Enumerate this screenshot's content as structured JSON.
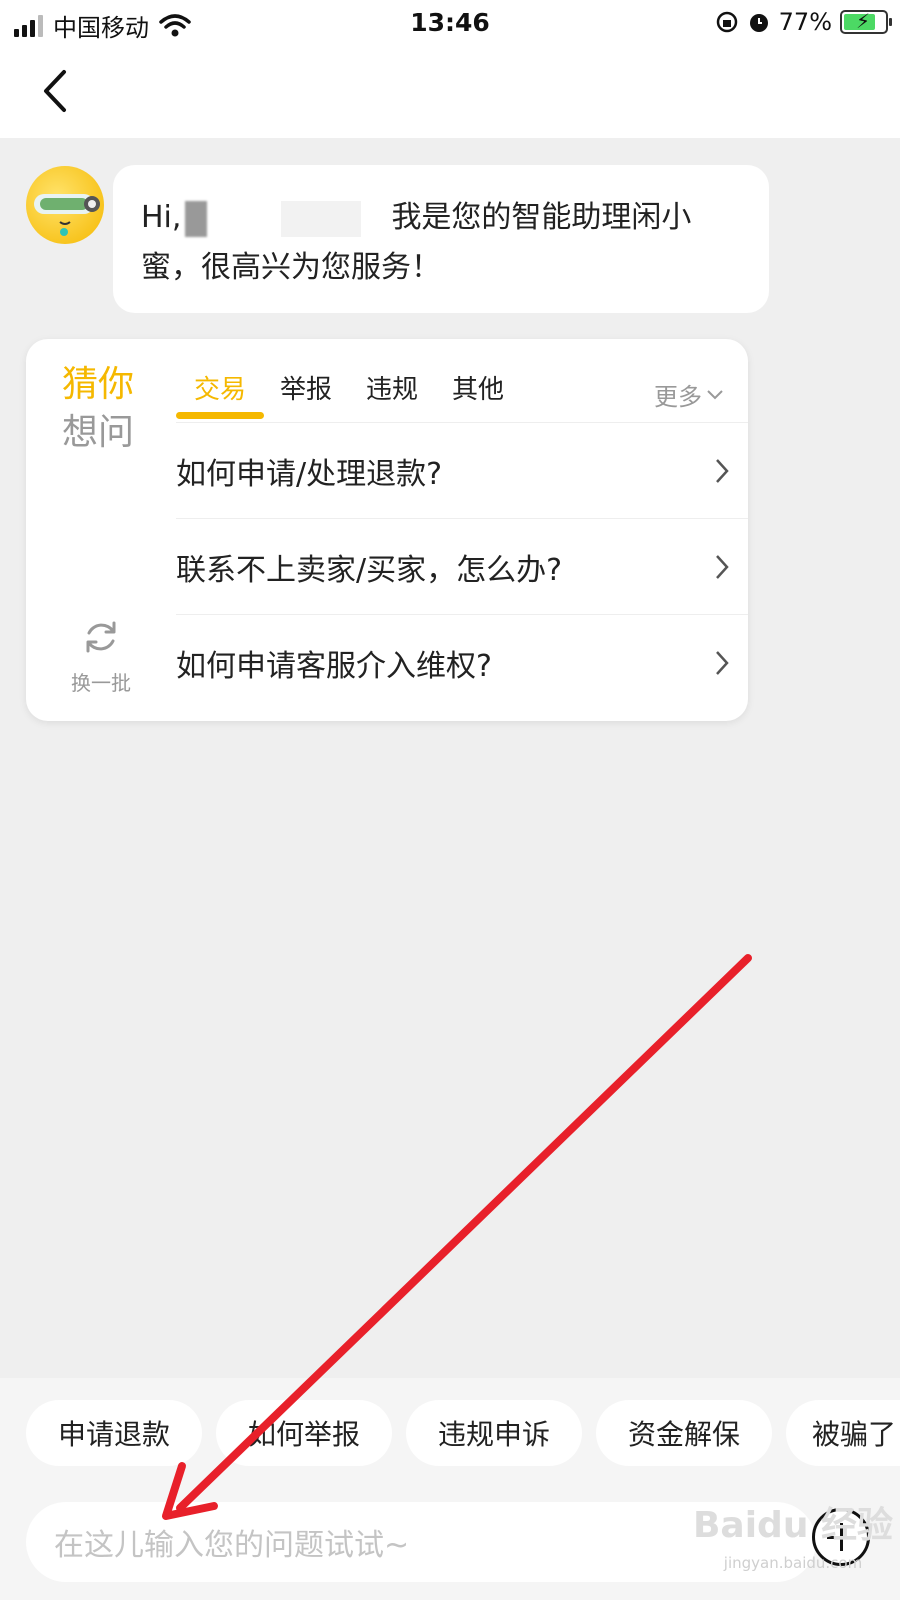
{
  "status_bar": {
    "carrier": "中国移动",
    "time": "13:46",
    "battery": "77%",
    "battery_level": 0.77
  },
  "chat": {
    "greeting_prefix": "Hi,",
    "greeting_text": "我是您的智能助理闲小蜜，很高兴为您服务！"
  },
  "guess_card": {
    "title_line1": "猜你",
    "title_line2": "想问",
    "refresh_label": "换一批",
    "tabs": [
      "交易",
      "举报",
      "违规",
      "其他"
    ],
    "active_tab": "交易",
    "more_label": "更多",
    "questions": [
      "如何申请/处理退款?",
      "联系不上卖家/买家，怎么办?",
      "如何申请客服介入维权?"
    ]
  },
  "quick_chips": [
    "申请退款",
    "如何举报",
    "违规申诉",
    "资金解保",
    "被骗了"
  ],
  "input": {
    "placeholder": "在这儿输入您的问题试试~"
  },
  "watermark": {
    "brand": "Baidu 经验",
    "url": "jingyan.baidu.com"
  },
  "colors": {
    "accent": "#f5b800",
    "annotation_arrow": "#e8202a",
    "background": "#efefef"
  }
}
